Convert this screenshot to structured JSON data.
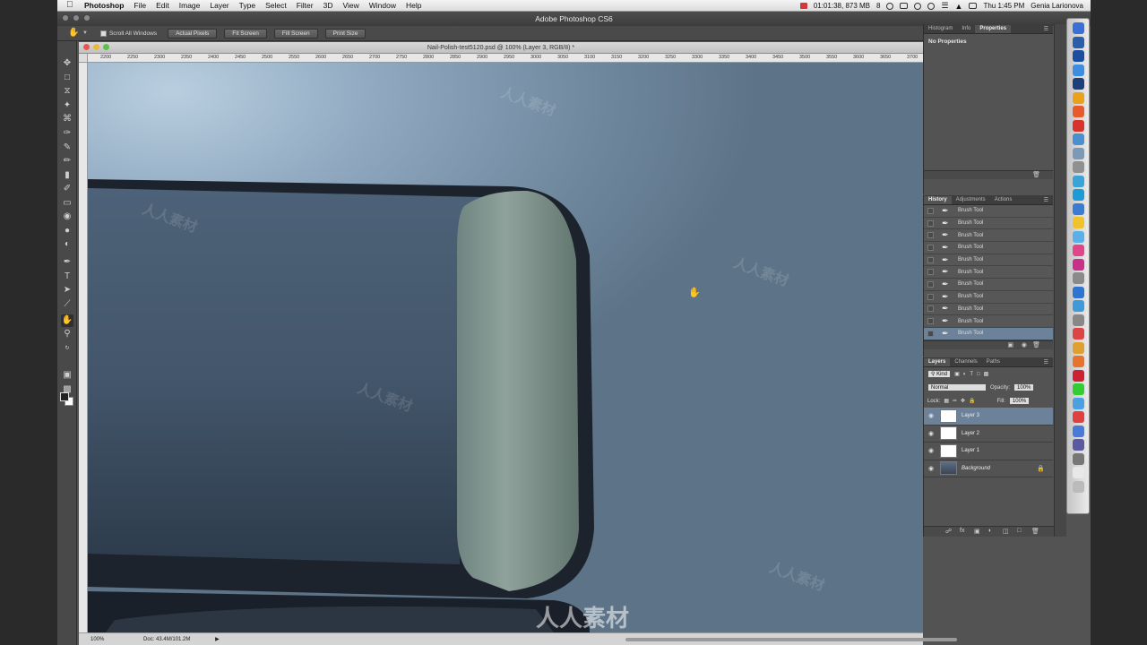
{
  "menubar": {
    "app_name": "Photoshop",
    "menus": [
      "File",
      "Edit",
      "Image",
      "Layer",
      "Type",
      "Select",
      "Filter",
      "3D",
      "View",
      "Window",
      "Help"
    ],
    "recording": "01:01:38, 873 MB",
    "battery_count": "8",
    "clock": "Thu 1:45 PM",
    "user": "Genia Larionova"
  },
  "window": {
    "title": "Adobe Photoshop CS6"
  },
  "options_bar": {
    "scroll_all_label": "Scroll All Windows",
    "buttons": [
      "Actual Pixels",
      "Fit Screen",
      "Fill Screen",
      "Print Size"
    ]
  },
  "document": {
    "tab_title": "Nail-Polish-test5120.psd @ 100% (Layer 3, RGB/8) *",
    "ruler_ticks": [
      "2200",
      "2250",
      "2300",
      "2350",
      "2400",
      "2450",
      "2500",
      "2550",
      "2600",
      "2650",
      "2700",
      "2750",
      "2800",
      "2850",
      "2900",
      "2950",
      "3000",
      "3050",
      "3100",
      "3150",
      "3200",
      "3250",
      "3300",
      "3350",
      "3400",
      "3450",
      "3500",
      "3550",
      "3600",
      "3650",
      "3700"
    ],
    "zoom": "100%",
    "doc_size": "Doc: 43.4M/101.2M"
  },
  "properties_panel": {
    "tabs": [
      "Histogram",
      "Info",
      "Properties"
    ],
    "active_tab": "Properties",
    "empty_text": "No Properties"
  },
  "history_panel": {
    "tabs": [
      "History",
      "Adjustments",
      "Actions"
    ],
    "items": [
      "Brush Tool",
      "Brush Tool",
      "Brush Tool",
      "Brush Tool",
      "Brush Tool",
      "Brush Tool",
      "Brush Tool",
      "Brush Tool",
      "Brush Tool",
      "Brush Tool",
      "Brush Tool"
    ]
  },
  "layers_panel": {
    "tabs": [
      "Layers",
      "Channels",
      "Paths"
    ],
    "filter_kind": "Kind",
    "blend_mode": "Normal",
    "opacity_label": "Opacity:",
    "opacity": "100%",
    "lock_label": "Lock:",
    "fill_label": "Fill:",
    "fill": "100%",
    "layers": [
      {
        "name": "Layer 3",
        "selected": true
      },
      {
        "name": "Layer 2",
        "selected": false
      },
      {
        "name": "Layer 1",
        "selected": false
      },
      {
        "name": "Background",
        "selected": false,
        "locked": true
      }
    ]
  },
  "watermark": "人人素材",
  "colors": {
    "accent_selected": "#6c829a",
    "panel_bg": "#535353"
  }
}
